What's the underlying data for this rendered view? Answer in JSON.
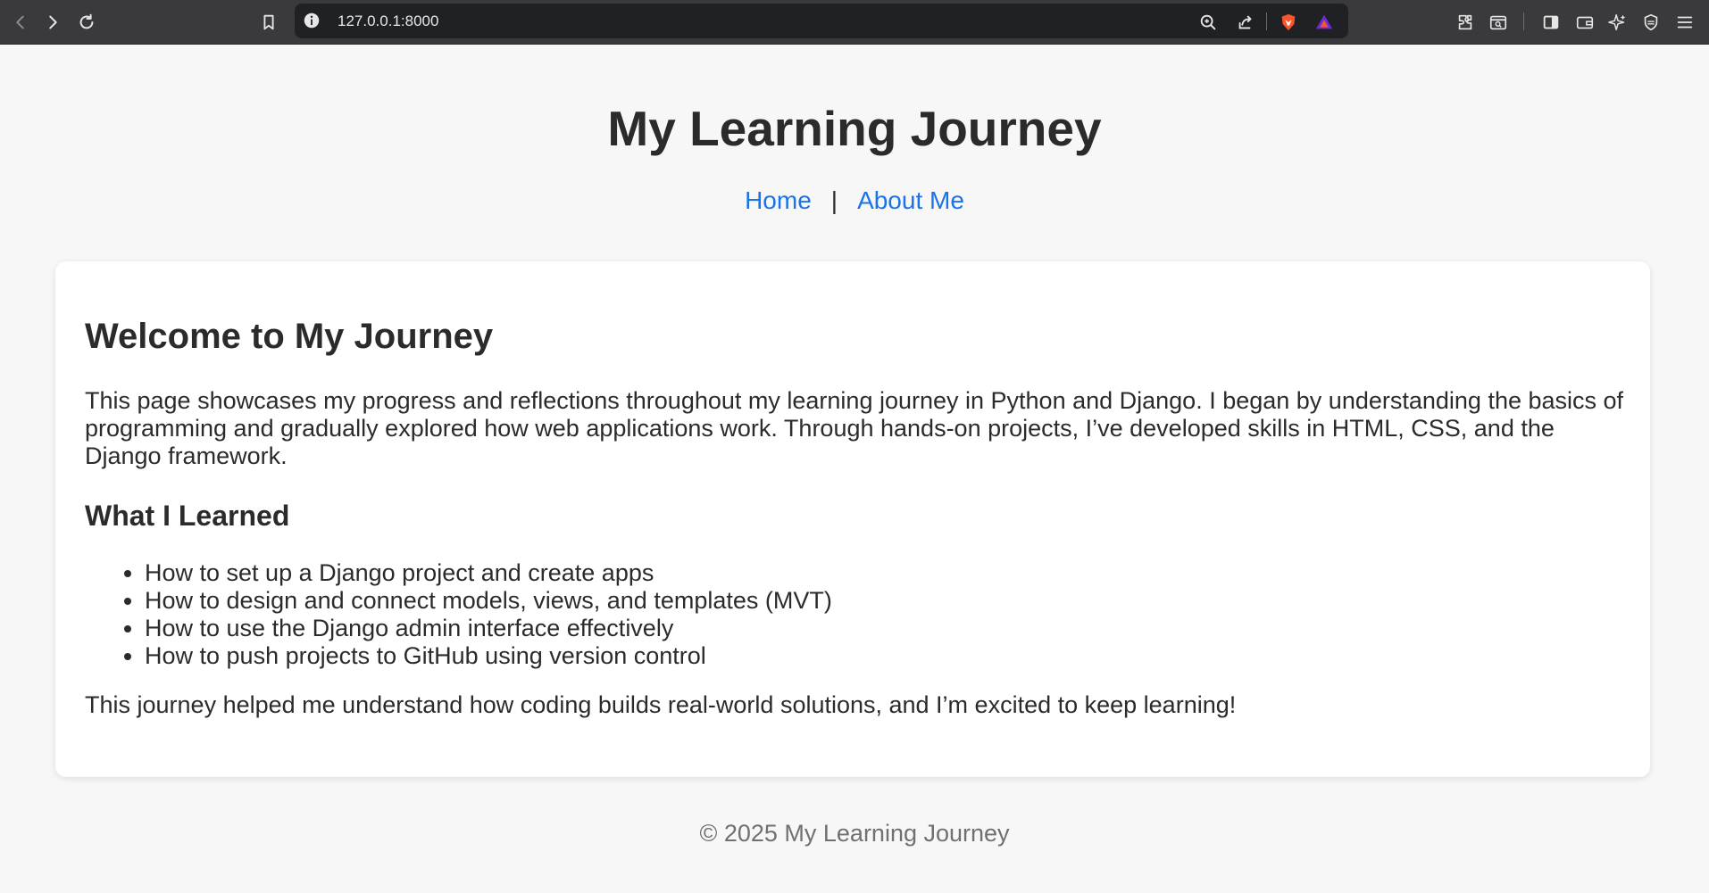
{
  "browser": {
    "url": "127.0.0.1:8000",
    "icons": [
      "back-icon",
      "forward-icon",
      "reload-icon",
      "bookmark-icon",
      "info-icon",
      "zoom-icon",
      "share-icon",
      "brave-shield-icon",
      "brave-rewards-icon",
      "extensions-icon",
      "tab-search-icon",
      "sidebar-icon",
      "wallet-icon",
      "leo-ai-icon",
      "vpn-icon",
      "menu-icon"
    ]
  },
  "header": {
    "title": "My Learning Journey",
    "nav": {
      "home": "Home",
      "separator": "|",
      "about": "About Me"
    }
  },
  "main": {
    "heading": "Welcome to My Journey",
    "intro": "This page showcases my progress and reflections throughout my learning journey in Python and Django. I began by understanding the basics of programming and gradually explored how web applications work. Through hands-on projects, I’ve developed skills in HTML, CSS, and the Django framework.",
    "subheading": "What I Learned",
    "learned": [
      "How to set up a Django project and create apps",
      "How to design and connect models, views, and templates (MVT)",
      "How to use the Django admin interface effectively",
      "How to push projects to GitHub using version control"
    ],
    "outro": "This journey helped me understand how coding builds real-world solutions, and I’m excited to keep learning!"
  },
  "footer": {
    "text": "© 2025 My Learning Journey"
  },
  "colors": {
    "link": "#1a73e8",
    "text": "#2b2b2b",
    "footer_text": "#707070",
    "page_bg": "#f7f7f8",
    "card_bg": "#ffffff",
    "chrome_bg": "#3a3a3d"
  }
}
